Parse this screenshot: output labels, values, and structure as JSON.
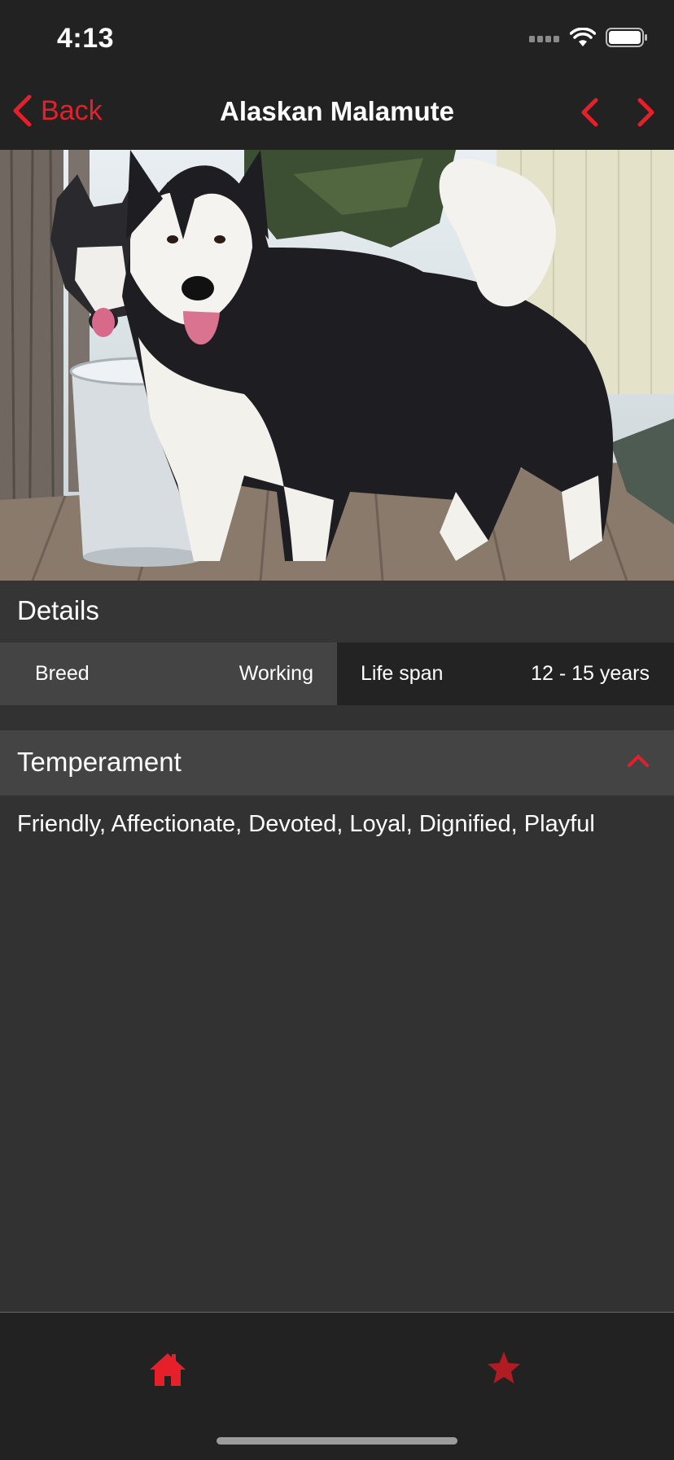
{
  "status_bar": {
    "time": "4:13"
  },
  "nav": {
    "back_label": "Back",
    "title": "Alaskan Malamute"
  },
  "details": {
    "header": "Details",
    "breed_label": "Breed",
    "breed_value": "Working",
    "lifespan_label": "Life span",
    "lifespan_value": "12 - 15 years"
  },
  "temperament": {
    "header": "Temperament",
    "text": "Friendly, Affectionate, Devoted, Loyal, Dignified, Playful"
  },
  "tabs": [
    {
      "icon": "home-icon",
      "active": true
    },
    {
      "icon": "star-icon",
      "active": false
    }
  ],
  "colors": {
    "accent": "#e5202a",
    "accent_dim": "#b11c22",
    "bg": "#323232",
    "bar": "#222222"
  }
}
